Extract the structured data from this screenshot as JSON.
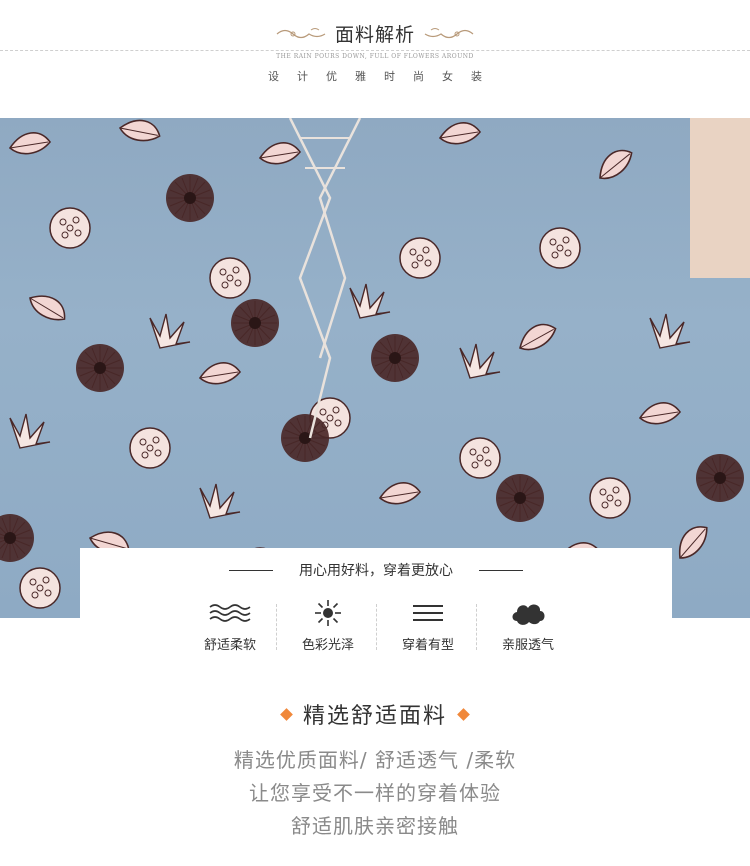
{
  "header": {
    "title": "面料解析",
    "subtitle_en": "THE RAIN POURS DOWN, FULL OF FLOWERS AROUND",
    "subtitle_cn": "设计优雅时尚女装"
  },
  "photo": {
    "description_icon": "floral-chiffon-fabric",
    "colors": {
      "base": "#93aec6",
      "dark": "#4a2b2b",
      "pink": "#f1d3d0"
    }
  },
  "card": {
    "title": "用心用好料，穿着更放心",
    "features": [
      {
        "icon": "wave-icon",
        "label": "舒适柔软"
      },
      {
        "icon": "sun-icon",
        "label": "色彩光泽"
      },
      {
        "icon": "lines-icon",
        "label": "穿着有型"
      },
      {
        "icon": "cloud-icon",
        "label": "亲服透气"
      }
    ]
  },
  "section": {
    "title": "精选舒适面料",
    "accent_color": "#f0883a",
    "lines": [
      "精选优质面料/ 舒适透气 /柔软",
      "让您享受不一样的穿着体验",
      "舒适肌肤亲密接触"
    ]
  }
}
